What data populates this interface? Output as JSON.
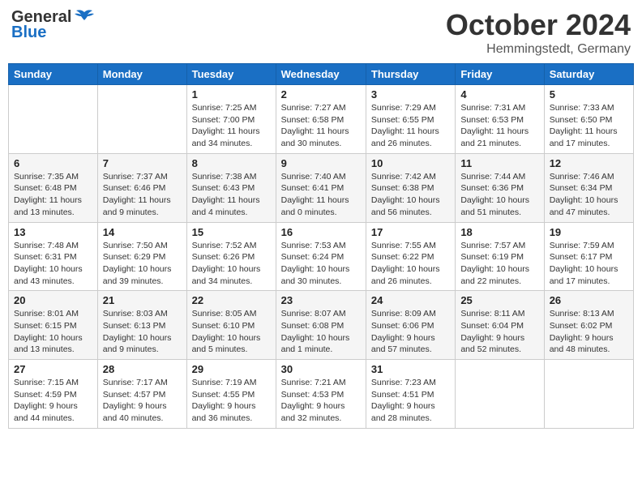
{
  "header": {
    "logo_general": "General",
    "logo_blue": "Blue",
    "month_title": "October 2024",
    "location": "Hemmingstedt, Germany"
  },
  "columns": [
    "Sunday",
    "Monday",
    "Tuesday",
    "Wednesday",
    "Thursday",
    "Friday",
    "Saturday"
  ],
  "weeks": [
    [
      {
        "day": "",
        "sunrise": "",
        "sunset": "",
        "daylight": ""
      },
      {
        "day": "",
        "sunrise": "",
        "sunset": "",
        "daylight": ""
      },
      {
        "day": "1",
        "sunrise": "Sunrise: 7:25 AM",
        "sunset": "Sunset: 7:00 PM",
        "daylight": "Daylight: 11 hours and 34 minutes."
      },
      {
        "day": "2",
        "sunrise": "Sunrise: 7:27 AM",
        "sunset": "Sunset: 6:58 PM",
        "daylight": "Daylight: 11 hours and 30 minutes."
      },
      {
        "day": "3",
        "sunrise": "Sunrise: 7:29 AM",
        "sunset": "Sunset: 6:55 PM",
        "daylight": "Daylight: 11 hours and 26 minutes."
      },
      {
        "day": "4",
        "sunrise": "Sunrise: 7:31 AM",
        "sunset": "Sunset: 6:53 PM",
        "daylight": "Daylight: 11 hours and 21 minutes."
      },
      {
        "day": "5",
        "sunrise": "Sunrise: 7:33 AM",
        "sunset": "Sunset: 6:50 PM",
        "daylight": "Daylight: 11 hours and 17 minutes."
      }
    ],
    [
      {
        "day": "6",
        "sunrise": "Sunrise: 7:35 AM",
        "sunset": "Sunset: 6:48 PM",
        "daylight": "Daylight: 11 hours and 13 minutes."
      },
      {
        "day": "7",
        "sunrise": "Sunrise: 7:37 AM",
        "sunset": "Sunset: 6:46 PM",
        "daylight": "Daylight: 11 hours and 9 minutes."
      },
      {
        "day": "8",
        "sunrise": "Sunrise: 7:38 AM",
        "sunset": "Sunset: 6:43 PM",
        "daylight": "Daylight: 11 hours and 4 minutes."
      },
      {
        "day": "9",
        "sunrise": "Sunrise: 7:40 AM",
        "sunset": "Sunset: 6:41 PM",
        "daylight": "Daylight: 11 hours and 0 minutes."
      },
      {
        "day": "10",
        "sunrise": "Sunrise: 7:42 AM",
        "sunset": "Sunset: 6:38 PM",
        "daylight": "Daylight: 10 hours and 56 minutes."
      },
      {
        "day": "11",
        "sunrise": "Sunrise: 7:44 AM",
        "sunset": "Sunset: 6:36 PM",
        "daylight": "Daylight: 10 hours and 51 minutes."
      },
      {
        "day": "12",
        "sunrise": "Sunrise: 7:46 AM",
        "sunset": "Sunset: 6:34 PM",
        "daylight": "Daylight: 10 hours and 47 minutes."
      }
    ],
    [
      {
        "day": "13",
        "sunrise": "Sunrise: 7:48 AM",
        "sunset": "Sunset: 6:31 PM",
        "daylight": "Daylight: 10 hours and 43 minutes."
      },
      {
        "day": "14",
        "sunrise": "Sunrise: 7:50 AM",
        "sunset": "Sunset: 6:29 PM",
        "daylight": "Daylight: 10 hours and 39 minutes."
      },
      {
        "day": "15",
        "sunrise": "Sunrise: 7:52 AM",
        "sunset": "Sunset: 6:26 PM",
        "daylight": "Daylight: 10 hours and 34 minutes."
      },
      {
        "day": "16",
        "sunrise": "Sunrise: 7:53 AM",
        "sunset": "Sunset: 6:24 PM",
        "daylight": "Daylight: 10 hours and 30 minutes."
      },
      {
        "day": "17",
        "sunrise": "Sunrise: 7:55 AM",
        "sunset": "Sunset: 6:22 PM",
        "daylight": "Daylight: 10 hours and 26 minutes."
      },
      {
        "day": "18",
        "sunrise": "Sunrise: 7:57 AM",
        "sunset": "Sunset: 6:19 PM",
        "daylight": "Daylight: 10 hours and 22 minutes."
      },
      {
        "day": "19",
        "sunrise": "Sunrise: 7:59 AM",
        "sunset": "Sunset: 6:17 PM",
        "daylight": "Daylight: 10 hours and 17 minutes."
      }
    ],
    [
      {
        "day": "20",
        "sunrise": "Sunrise: 8:01 AM",
        "sunset": "Sunset: 6:15 PM",
        "daylight": "Daylight: 10 hours and 13 minutes."
      },
      {
        "day": "21",
        "sunrise": "Sunrise: 8:03 AM",
        "sunset": "Sunset: 6:13 PM",
        "daylight": "Daylight: 10 hours and 9 minutes."
      },
      {
        "day": "22",
        "sunrise": "Sunrise: 8:05 AM",
        "sunset": "Sunset: 6:10 PM",
        "daylight": "Daylight: 10 hours and 5 minutes."
      },
      {
        "day": "23",
        "sunrise": "Sunrise: 8:07 AM",
        "sunset": "Sunset: 6:08 PM",
        "daylight": "Daylight: 10 hours and 1 minute."
      },
      {
        "day": "24",
        "sunrise": "Sunrise: 8:09 AM",
        "sunset": "Sunset: 6:06 PM",
        "daylight": "Daylight: 9 hours and 57 minutes."
      },
      {
        "day": "25",
        "sunrise": "Sunrise: 8:11 AM",
        "sunset": "Sunset: 6:04 PM",
        "daylight": "Daylight: 9 hours and 52 minutes."
      },
      {
        "day": "26",
        "sunrise": "Sunrise: 8:13 AM",
        "sunset": "Sunset: 6:02 PM",
        "daylight": "Daylight: 9 hours and 48 minutes."
      }
    ],
    [
      {
        "day": "27",
        "sunrise": "Sunrise: 7:15 AM",
        "sunset": "Sunset: 4:59 PM",
        "daylight": "Daylight: 9 hours and 44 minutes."
      },
      {
        "day": "28",
        "sunrise": "Sunrise: 7:17 AM",
        "sunset": "Sunset: 4:57 PM",
        "daylight": "Daylight: 9 hours and 40 minutes."
      },
      {
        "day": "29",
        "sunrise": "Sunrise: 7:19 AM",
        "sunset": "Sunset: 4:55 PM",
        "daylight": "Daylight: 9 hours and 36 minutes."
      },
      {
        "day": "30",
        "sunrise": "Sunrise: 7:21 AM",
        "sunset": "Sunset: 4:53 PM",
        "daylight": "Daylight: 9 hours and 32 minutes."
      },
      {
        "day": "31",
        "sunrise": "Sunrise: 7:23 AM",
        "sunset": "Sunset: 4:51 PM",
        "daylight": "Daylight: 9 hours and 28 minutes."
      },
      {
        "day": "",
        "sunrise": "",
        "sunset": "",
        "daylight": ""
      },
      {
        "day": "",
        "sunrise": "",
        "sunset": "",
        "daylight": ""
      }
    ]
  ]
}
